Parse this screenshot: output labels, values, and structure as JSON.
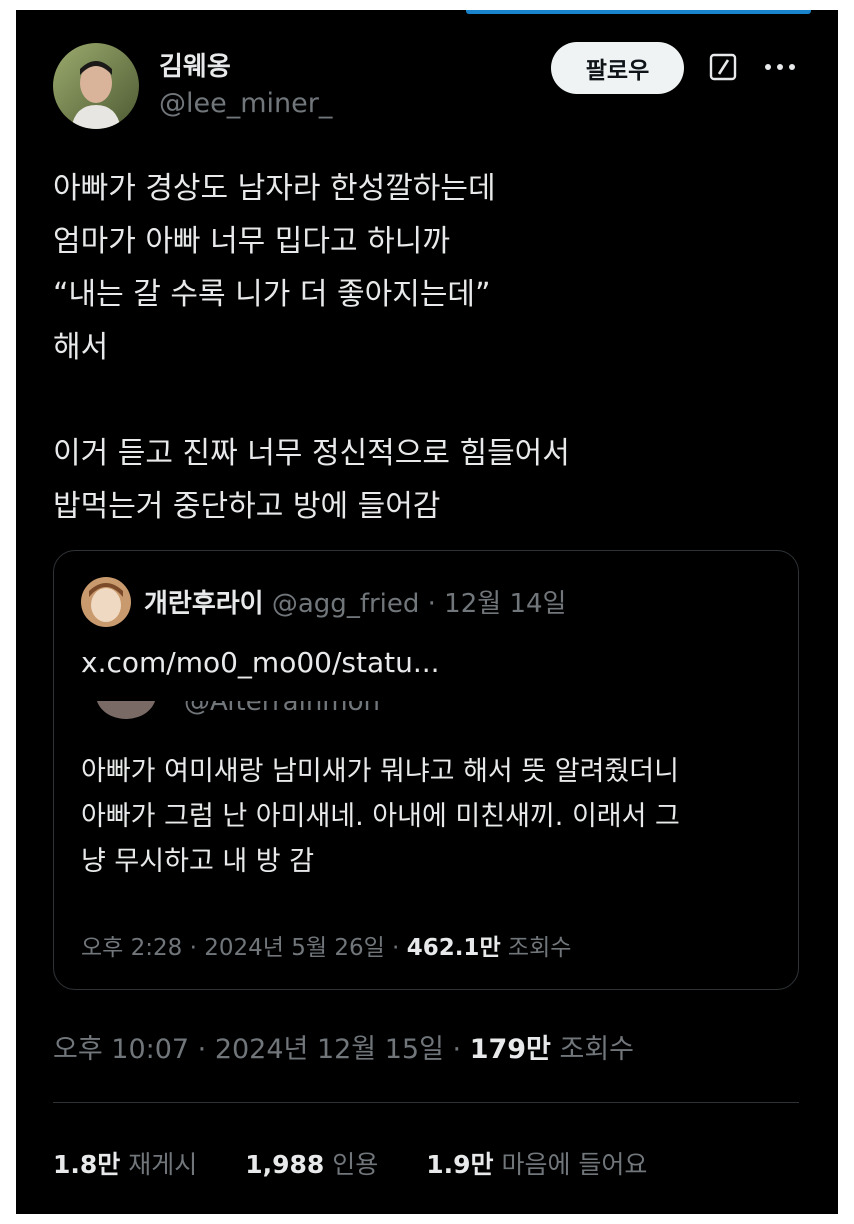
{
  "post": {
    "author": {
      "display_name": "김웨옹",
      "handle": "@lee_miner_"
    },
    "follow_label": "팔로우",
    "body_lines": [
      "아빠가 경상도 남자라 한성깔하는데",
      "엄마가 아빠 너무 밉다고 하니까",
      "“내는 갈 수록 니가 더 좋아지는데”",
      "해서",
      "",
      "이거 듣고 진짜 너무 정신적으로 힘들어서",
      "밥먹는거 중단하고 방에 들어감"
    ],
    "meta": {
      "time": "오후 10:07 · 2024년 12월 15일 · ",
      "views": "179만",
      "views_label": " 조회수"
    },
    "stats": {
      "reposts": "1.8만",
      "reposts_label": "재게시",
      "quotes": "1,988",
      "quotes_label": "인용",
      "likes": "1.9만",
      "likes_label": "마음에 들어요"
    }
  },
  "quote": {
    "display_name": "개란후라이",
    "handle_date": " @agg_fried · 12월 14일",
    "link_text": "x.com/mo0_mo00/statu...",
    "nested": {
      "handle_peek": "@Afterrainmon",
      "body_lines": [
        "아빠가 여미새랑 남미새가 뭐냐고 해서 뜻 알려줬더니",
        "아빠가 그럼 난 아미새네. 아내에 미친새끼. 이래서 그",
        "냥 무시하고 내 방 감"
      ],
      "meta_time": "오후 2:28 · 2024년 5월 26일 · ",
      "views": "462.1만",
      "views_label": " 조회수"
    }
  },
  "colors": {
    "background": "#000000",
    "text_primary": "#e7e9ea",
    "text_secondary": "#71767b",
    "border": "#2f3336",
    "follow_button_bg": "#eff3f4"
  },
  "icons": [
    "grok-icon",
    "more-icon"
  ]
}
